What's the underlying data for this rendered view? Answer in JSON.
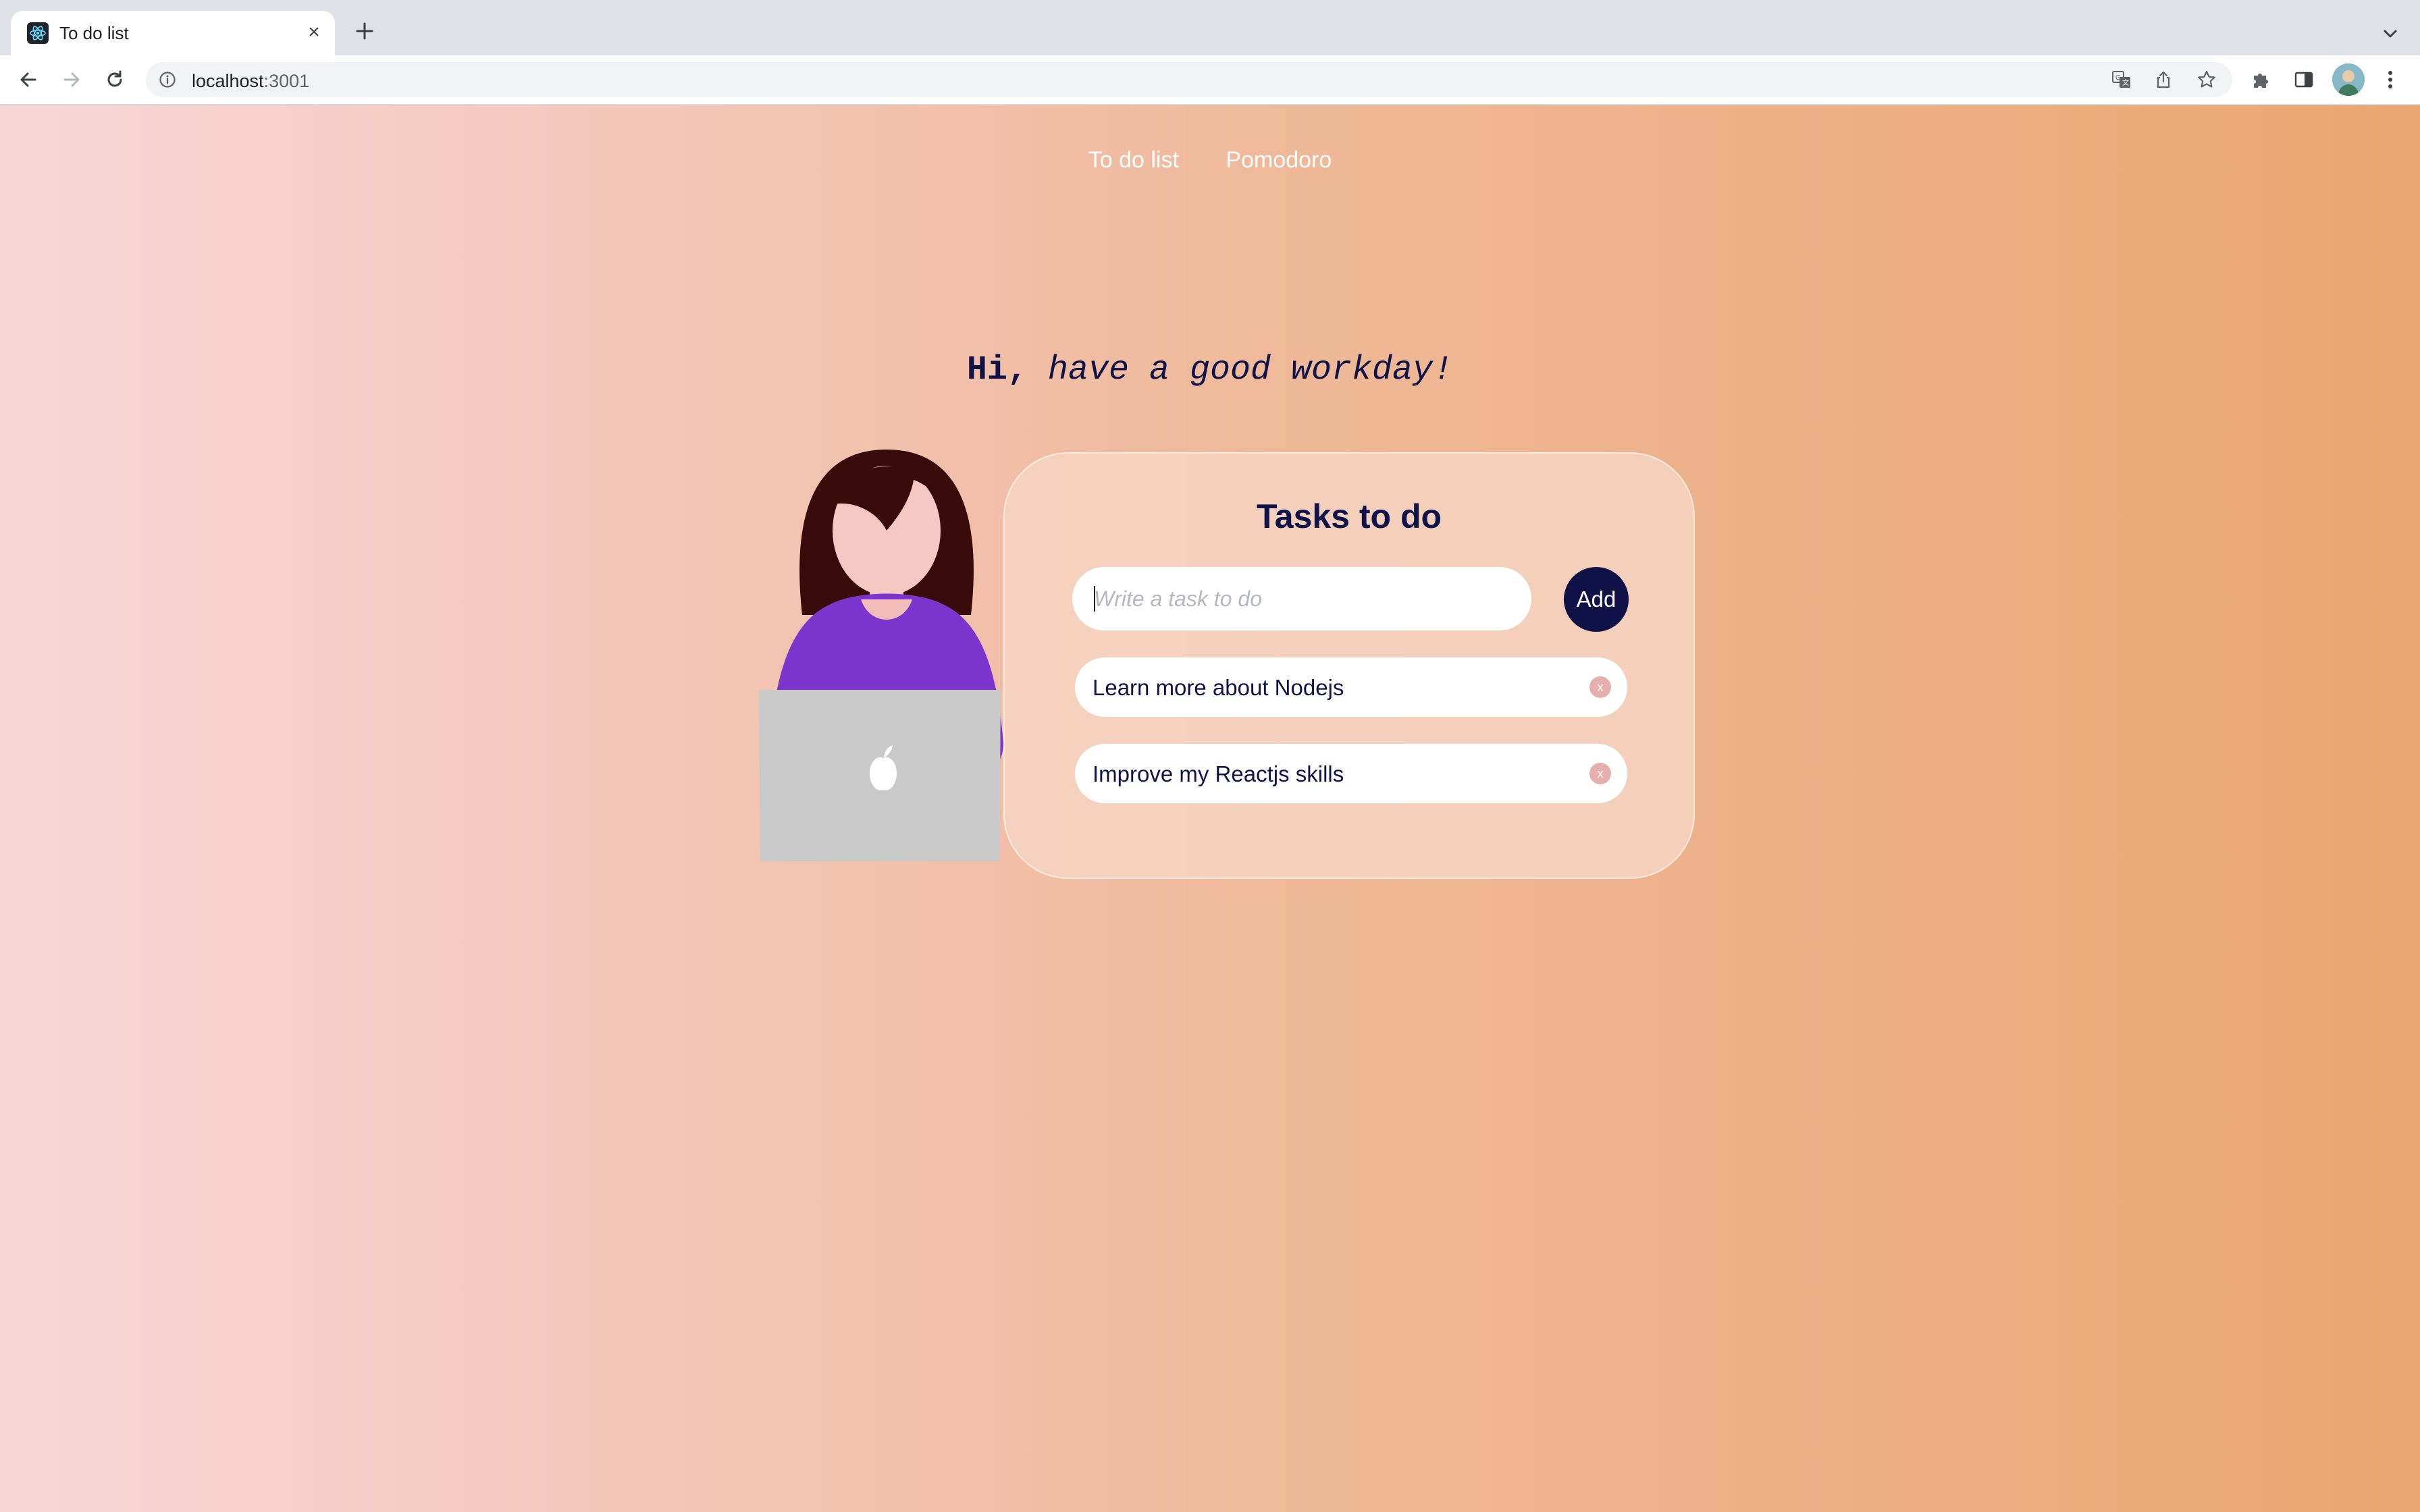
{
  "browser": {
    "tab_title": "To do list",
    "tab_close_glyph": "×",
    "new_tab_icon": "plus-icon",
    "url_host": "localhost",
    "url_port": ":3001",
    "colors": {
      "tabstrip": "#dee1e6",
      "toolbar": "#ffffff",
      "omnibox": "#f1f3f4"
    }
  },
  "nav": {
    "items": [
      "To do list",
      "Pomodoro"
    ]
  },
  "greeting": {
    "hi": "Hi,",
    "message": "have a good workday!"
  },
  "tasks": {
    "title": "Tasks to do",
    "input_placeholder": "Write a task to do",
    "add_label": "Add",
    "items": [
      {
        "text": "Learn more about Nodejs",
        "delete_glyph": "x"
      },
      {
        "text": "Improve my Reactjs skills",
        "delete_glyph": "x"
      }
    ]
  },
  "colors": {
    "accent_dark": "#10124a",
    "add_button": "#0f1147",
    "gradient_start": "#f7d7d6",
    "gradient_end": "#e9a671",
    "delete_dot": "#e7aeae",
    "shirt": "#7b35cc",
    "hair": "#380a0a",
    "skin": "#f5c8c4",
    "laptop": "#c7c7c7"
  }
}
